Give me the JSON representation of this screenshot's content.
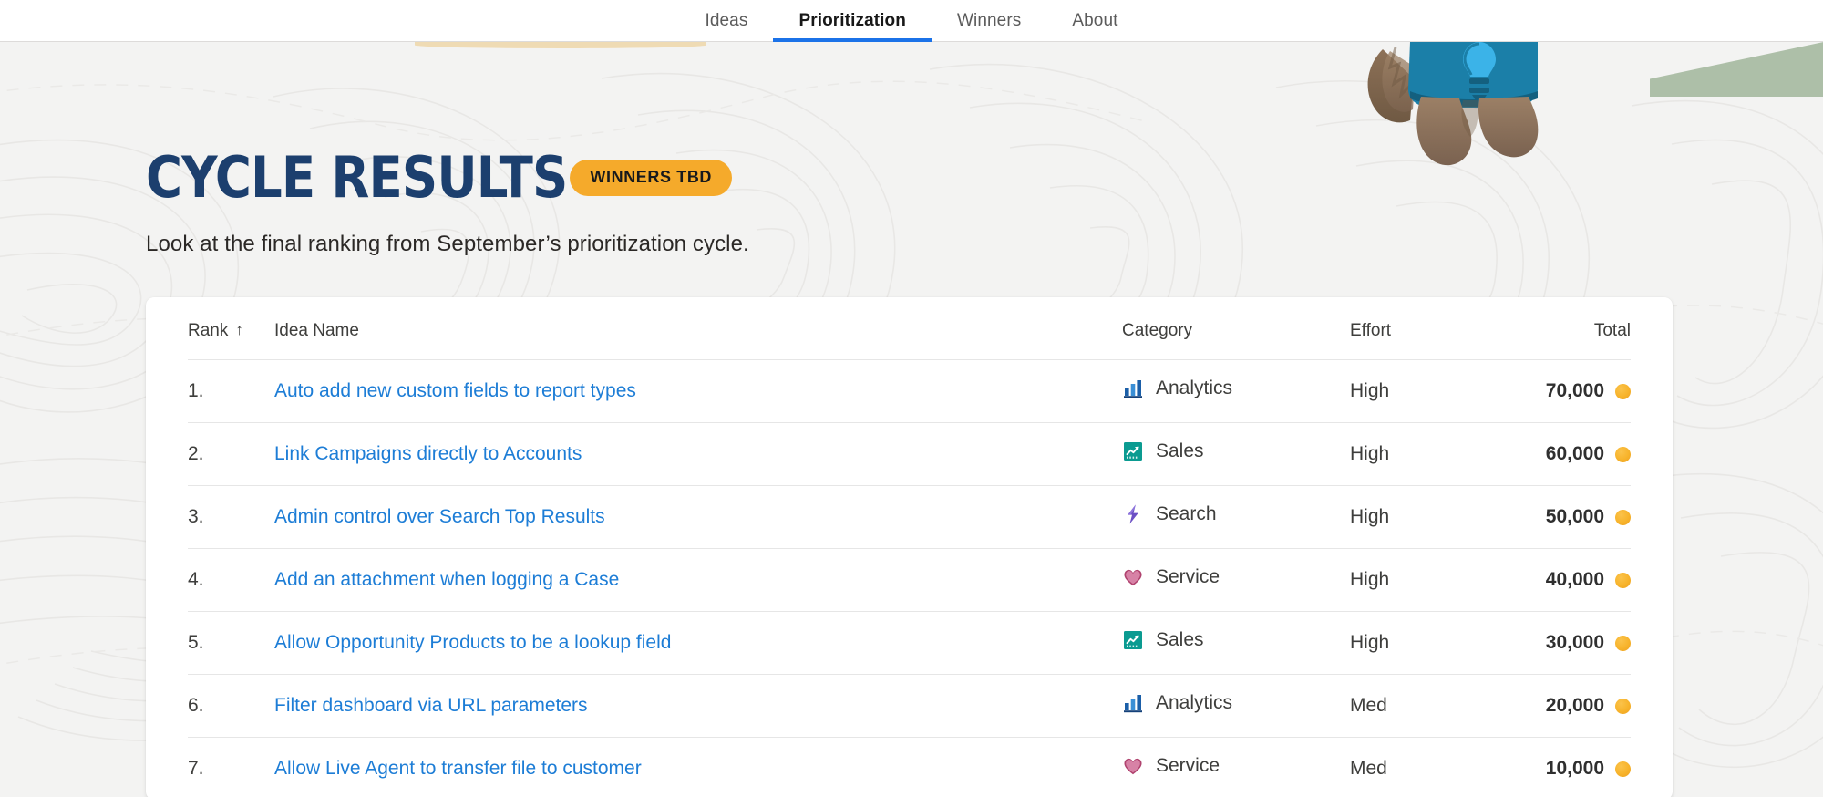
{
  "nav": {
    "items": [
      {
        "label": "Ideas",
        "active": false
      },
      {
        "label": "Prioritization",
        "active": true
      },
      {
        "label": "Winners",
        "active": false
      },
      {
        "label": "About",
        "active": false
      }
    ],
    "active_underline_color": "#1b72e8"
  },
  "header": {
    "title": "CYCLE RESULTS",
    "title_color": "#1c3f6e",
    "badge": {
      "label": "WINNERS TBD",
      "background": "#f5aa2b",
      "text_color": "#17191c"
    },
    "subtitle": "Look at the final ranking from September’s prioritization cycle."
  },
  "table": {
    "columns": {
      "rank": "Rank",
      "rank_sort_indicator": "↑",
      "idea_name": "Idea Name",
      "category": "Category",
      "effort": "Effort",
      "total": "Total"
    },
    "link_color": "#1d7dd6",
    "coin_color": "#f7b32b",
    "rows": [
      {
        "rank": "1.",
        "idea_name": "Auto add new custom fields to report types",
        "category": "Analytics",
        "category_icon": "analytics-bar-chart-icon",
        "effort": "High",
        "total": "70,000"
      },
      {
        "rank": "2.",
        "idea_name": "Link Campaigns directly to Accounts",
        "category": "Sales",
        "category_icon": "sales-trend-up-icon",
        "effort": "High",
        "total": "60,000"
      },
      {
        "rank": "3.",
        "idea_name": "Admin control over Search Top Results",
        "category": "Search",
        "category_icon": "search-lightning-bolt-icon",
        "effort": "High",
        "total": "50,000"
      },
      {
        "rank": "4.",
        "idea_name": "Add an attachment when logging a Case",
        "category": "Service",
        "category_icon": "service-heart-icon",
        "effort": "High",
        "total": "40,000"
      },
      {
        "rank": "5.",
        "idea_name": "Allow Opportunity Products to be a lookup field",
        "category": "Sales",
        "category_icon": "sales-trend-up-icon",
        "effort": "High",
        "total": "30,000"
      },
      {
        "rank": "6.",
        "idea_name": "Filter dashboard via URL parameters",
        "category": "Analytics",
        "category_icon": "analytics-bar-chart-icon",
        "effort": "Med",
        "total": "20,000"
      },
      {
        "rank": "7.",
        "idea_name": "Allow Live Agent to transfer file to customer",
        "category": "Service",
        "category_icon": "service-heart-icon",
        "effort": "Med",
        "total": "10,000"
      }
    ]
  },
  "decoration": {
    "background_color": "#f3f3f2",
    "topo_line_color": "#e2e1de",
    "corner_green": "#adbfa8",
    "corner_tan": "#efdbb4",
    "mascot": "salesforce-mascot-illustration"
  }
}
